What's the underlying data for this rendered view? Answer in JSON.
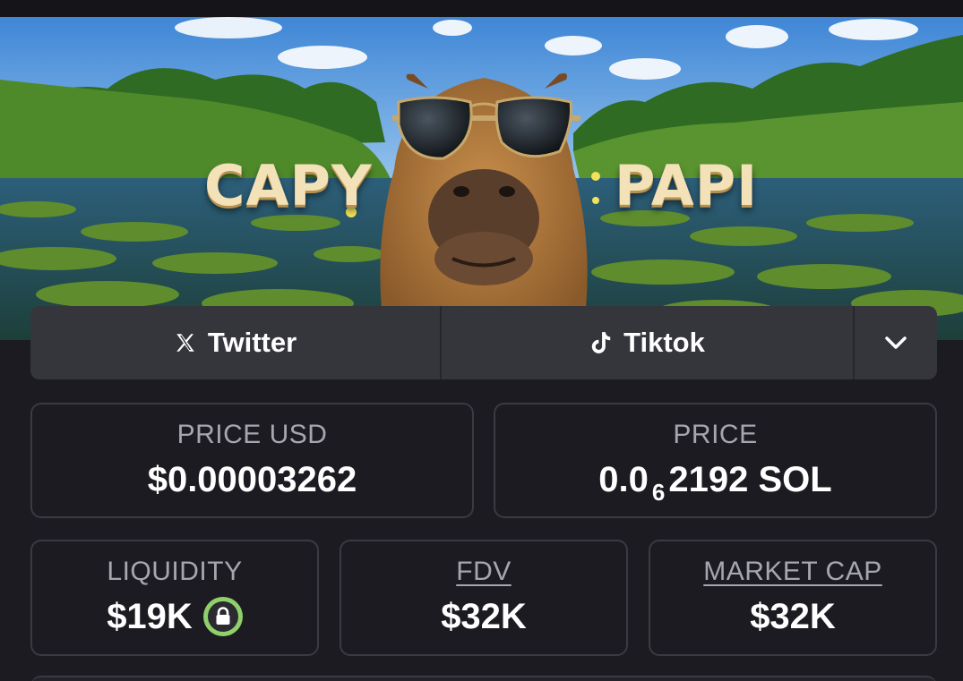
{
  "banner": {
    "word_left": "CAPY",
    "word_right": "PAPI"
  },
  "social": {
    "twitter_label": "Twitter",
    "twitter_icon": "x-icon",
    "tiktok_label": "Tiktok",
    "tiktok_icon": "tiktok-icon",
    "more_icon": "chevron-down-icon"
  },
  "stats": {
    "price_usd": {
      "label": "PRICE USD",
      "value": "$0.00003262"
    },
    "price": {
      "label": "PRICE",
      "prefix": "0.0",
      "zeros": "6",
      "suffix": "2192 SOL"
    },
    "liquidity": {
      "label": "LIQUIDITY",
      "value": "$19K",
      "icon": "lock-icon"
    },
    "fdv": {
      "label": "FDV",
      "value": "$32K"
    },
    "market_cap": {
      "label": "MARKET CAP",
      "value": "$32K"
    }
  },
  "colors": {
    "background": "#1b1b21",
    "button": "#35353c",
    "card_border": "#3a3a42",
    "label": "#a6a6ae",
    "lock_green": "#8fd06a"
  }
}
